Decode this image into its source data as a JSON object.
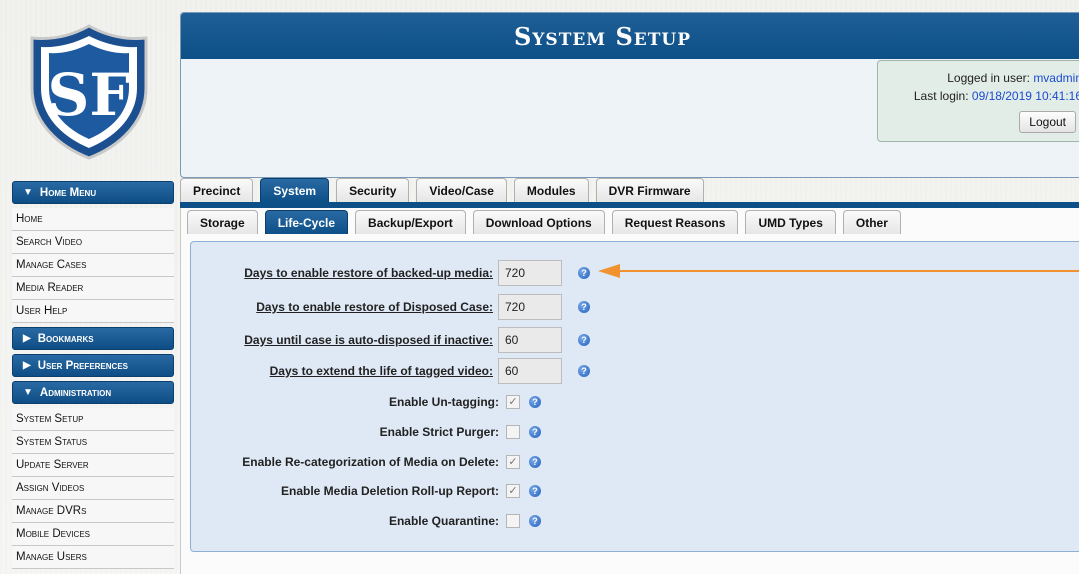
{
  "header": {
    "title": "System Setup"
  },
  "login": {
    "user_label": "Logged in user:",
    "user_value": "mvadmin",
    "last_login_label": "Last login:",
    "last_login_value": "09/18/2019 10:41:16",
    "logout_label": "Logout"
  },
  "sidebar": {
    "home_menu": {
      "label": "Home Menu",
      "items": [
        "Home",
        "Search Video",
        "Manage Cases",
        "Media Reader",
        "User Help"
      ]
    },
    "bookmarks": {
      "label": "Bookmarks"
    },
    "user_prefs": {
      "label": "User Preferences"
    },
    "administration": {
      "label": "Administration",
      "items": [
        "System Setup",
        "System Status",
        "Update Server",
        "Assign Videos",
        "Manage DVRs",
        "Mobile Devices",
        "Manage Users"
      ]
    }
  },
  "tabs": {
    "top": [
      "Precinct",
      "System",
      "Security",
      "Video/Case",
      "Modules",
      "DVR Firmware"
    ],
    "top_active": "System",
    "sub": [
      "Storage",
      "Life-Cycle",
      "Backup/Export",
      "Download Options",
      "Request Reasons",
      "UMD Types",
      "Other"
    ],
    "sub_active": "Life-Cycle"
  },
  "settings": {
    "numeric": [
      {
        "label": "Days to enable restore of backed-up media:",
        "value": "720"
      },
      {
        "label": "Days to enable restore of Disposed Case:",
        "value": "720"
      },
      {
        "label": "Days until case is auto-disposed if inactive:",
        "value": "60"
      },
      {
        "label": "Days to extend the life of tagged video:",
        "value": "60"
      }
    ],
    "checkboxes": [
      {
        "label": "Enable Un-tagging:",
        "checked": true
      },
      {
        "label": "Enable Strict Purger:",
        "checked": false
      },
      {
        "label": "Enable Re-categorization of Media on Delete:",
        "checked": true
      },
      {
        "label": "Enable Media Deletion Roll-up Report:",
        "checked": true
      },
      {
        "label": "Enable Quarantine:",
        "checked": false
      }
    ]
  },
  "colors": {
    "brand_blue": "#0d4f87",
    "arrow_orange": "#f0922e",
    "link_blue": "#1a4bd0"
  },
  "icons": {
    "help": "help-circle-icon",
    "menu_open": "triangle-down-icon",
    "menu_closed": "triangle-right-icon"
  }
}
